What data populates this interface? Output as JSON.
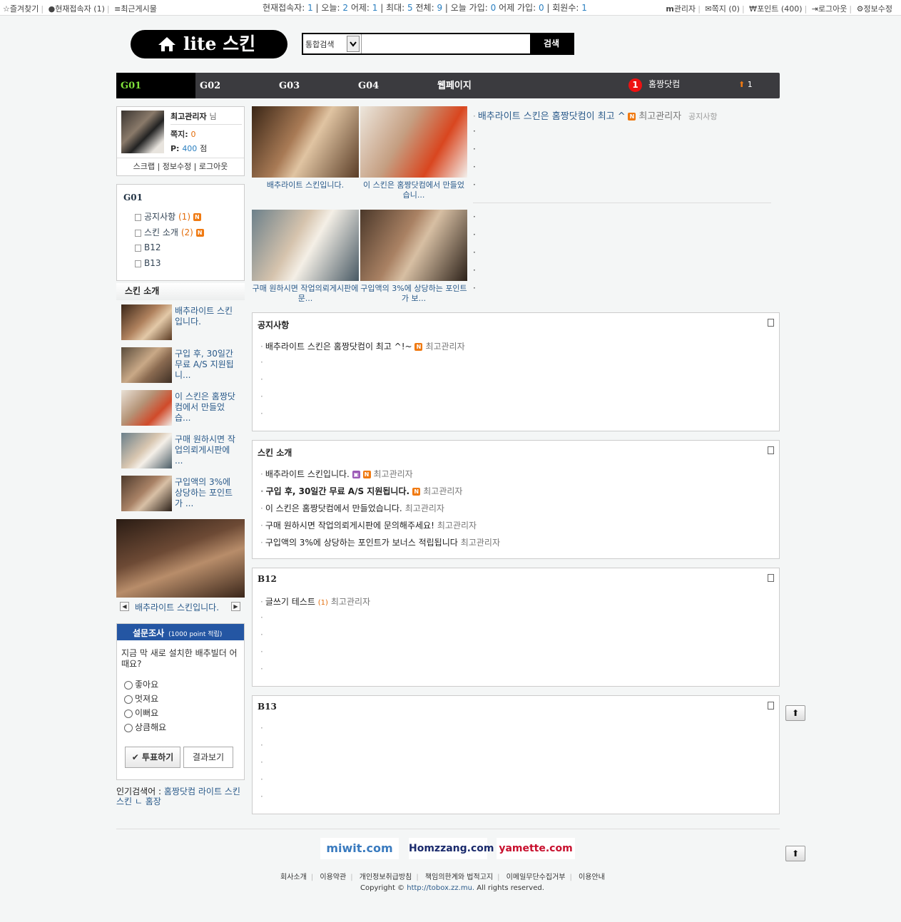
{
  "topbar": {
    "left": [
      "즐겨찾기",
      "현재접속자 (1)",
      "최근게시물"
    ],
    "stats": [
      {
        "label": "현재접속자:",
        "value": "1"
      },
      {
        "label": "오늘:",
        "value": "2"
      },
      {
        "label": "어제:",
        "value": "1"
      },
      {
        "label": "최대:",
        "value": "5"
      },
      {
        "label": "전체:",
        "value": "9"
      },
      {
        "label": "오늘 가입:",
        "value": "0"
      },
      {
        "label": "어제 가입:",
        "value": "0"
      },
      {
        "label": "회원수:",
        "value": "1"
      }
    ],
    "right": [
      "관리자",
      "쪽지 (0)",
      "포인트 (400)",
      "로그아웃",
      "정보수정"
    ]
  },
  "logo": {
    "text": "lite 스킨"
  },
  "search": {
    "select": "통합검색",
    "button": "검색"
  },
  "nav": {
    "items": [
      "G01",
      "G02",
      "G03",
      "G04",
      "웹페이지"
    ],
    "badge": "1",
    "site": "홈짱닷컴",
    "up": "1"
  },
  "profile": {
    "name": "최고관리자",
    "suffix": "님",
    "memo_label": "쪽지:",
    "memo_value": "0",
    "point_label": "P:",
    "point_value": "400",
    "point_unit": "점",
    "links": [
      "스크랩",
      "정보수정",
      "로그아웃"
    ]
  },
  "category": {
    "title": "G01",
    "items": [
      {
        "name": "공지사항",
        "count": "(1)"
      },
      {
        "name": "스킨 소개",
        "count": "(2)"
      },
      {
        "name": "B12",
        "count": ""
      },
      {
        "name": "B13",
        "count": ""
      }
    ]
  },
  "skin_intro": {
    "title": "스킨 소개",
    "items": [
      "배추라이트 스킨입니다.",
      "구입 후, 30일간 무료 A/S 지원됩니...",
      "이 스킨은 홈짱닷컴에서 만들었습...",
      "구매 원하시면 작업의뢰게시판에 ...",
      "구입액의 3%에 상당하는 포인트가 ..."
    ]
  },
  "slider": {
    "caption": "배추라이트 스킨입니다."
  },
  "poll": {
    "title": "설문조사",
    "sub": "(1000 point 적립)",
    "question": "지금 막 새로 설치한 배추빌더 어때요?",
    "options": [
      "좋아요",
      "멋져요",
      "이뻐요",
      "상큼해요"
    ],
    "vote": "투표하기",
    "result": "결과보기"
  },
  "popular": {
    "label": "인기검색어 :",
    "words": "홈짱닷컴 라이트 스킨 스킨 ㄴ 홈장"
  },
  "gallery": {
    "captions": [
      "배추라이트 스킨입니다.",
      "이 스킨은 홈짱닷컴에서 만들었습니...",
      "구매 원하시면 작업의뢰게시판에 문...",
      "구입액의 3%에 상당하는 포인트가 보..."
    ],
    "latest": {
      "title": "배추라이트 스킨은 홈짱닷컴이 최고 ^",
      "author": "최고관리자",
      "board": "공지사항"
    }
  },
  "boards": [
    {
      "title": "공지사항",
      "rows": [
        {
          "text": "배추라이트 스킨은 홈짱닷컴이 최고 ^!~",
          "author": "최고관리자"
        }
      ]
    },
    {
      "title": "스킨 소개",
      "rows": [
        {
          "text": "배추라이트 스킨입니다.",
          "author": "최고관리자"
        },
        {
          "text": "구입 후, 30일간 무료 A/S 지원됩니다.",
          "author": "최고관리자"
        },
        {
          "text": "이 스킨은 홈짱닷컴에서 만들었습니다.",
          "author": "최고관리자"
        },
        {
          "text": "구매 원하시면 작업의뢰게시판에 문의해주세요!",
          "author": "최고관리자"
        },
        {
          "text": "구입액의 3%에 상당하는 포인트가 보너스 적립됩니다",
          "author": "최고관리자"
        }
      ]
    },
    {
      "title": "B12",
      "rows": [
        {
          "text": "글쓰기 테스트",
          "count": "(1)",
          "author": "최고관리자"
        }
      ]
    },
    {
      "title": "B13",
      "rows": []
    }
  ],
  "footer": {
    "logos": [
      "miwit.com",
      "Homzzang.com",
      "yamette.com"
    ],
    "links": [
      "회사소개",
      "이용약관",
      "개인정보취급방침",
      "책임의한계와 법적고지",
      "이메일무단수집거부",
      "이용안내"
    ],
    "copyright_prefix": "Copyright ©",
    "copyright_url": "http://tobox.zz.mu.",
    "copyright_suffix": "All rights reserved."
  },
  "colors": {
    "accent": "#2a7fc0",
    "nav_bg": "#3b3b3f",
    "nav_active": "#7fe23a",
    "poll_head": "#2456a3",
    "new_badge": "#f07a12"
  }
}
